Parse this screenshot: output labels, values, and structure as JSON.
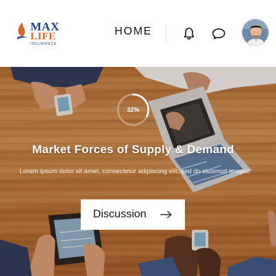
{
  "header": {
    "logo": {
      "line1": "MAX",
      "line2": "LIFE",
      "line3": "INSURANCE"
    },
    "nav": {
      "home_label": "HOME"
    },
    "icons": {
      "notifications": "bell-icon",
      "messages": "chat-bubble-icon",
      "profile": "avatar"
    }
  },
  "hero": {
    "progress": {
      "value": 0.32,
      "label": "32%"
    },
    "title": "Market Forces of Supply & Demand",
    "description": "Lorem ipsum dolor sit amet, consectetur adipiscing elit, sed do eiusmod tempor.",
    "cta": {
      "label": "Discussion",
      "icon": "arrow-right-icon"
    }
  },
  "colors": {
    "brand_blue": "#1f3f8a",
    "brand_orange": "#e2622b",
    "wood": "#c08040",
    "text_dark": "#111111"
  }
}
